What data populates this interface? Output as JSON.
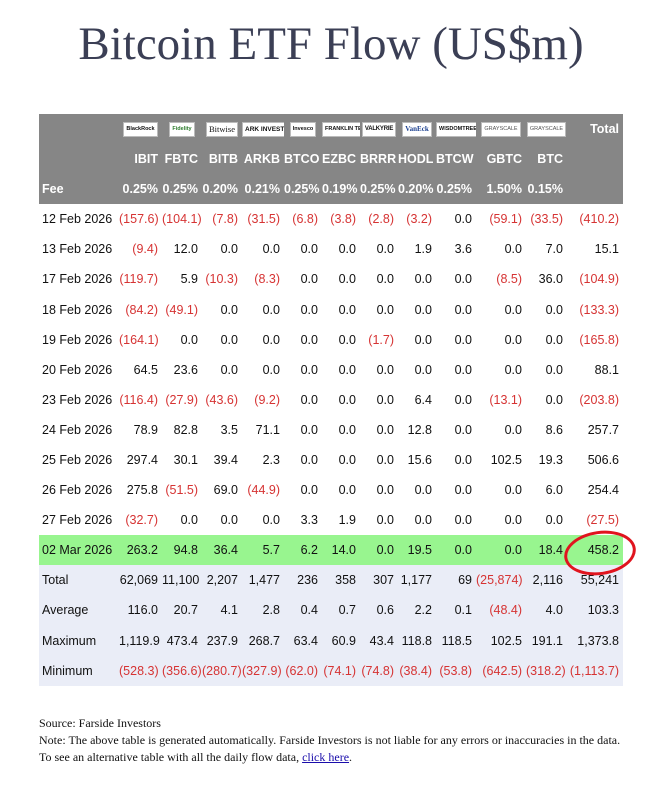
{
  "title": "Bitcoin ETF Flow (US$m)",
  "brands": [
    "BlackRock",
    "Fidelity",
    "Bitwise",
    "ARK INVEST",
    "Invesco",
    "FRANKLIN TEMPLETON",
    "VALKYRIE",
    "VanEck",
    "WISDOMTREE",
    "GRAYSCALE",
    "GRAYSCALE"
  ],
  "total_header": "Total",
  "tickers": [
    "IBIT",
    "FBTC",
    "BITB",
    "ARKB",
    "BTCO",
    "EZBC",
    "BRRR",
    "HODL",
    "BTCW",
    "GBTC",
    "BTC"
  ],
  "fee_label": "Fee",
  "fees": [
    "0.25%",
    "0.25%",
    "0.20%",
    "0.21%",
    "0.25%",
    "0.19%",
    "0.25%",
    "0.20%",
    "0.25%",
    "1.50%",
    "0.15%"
  ],
  "rows": [
    {
      "date": "12 Feb 2026",
      "values": [
        "(157.6)",
        "(104.1)",
        "(7.8)",
        "(31.5)",
        "(6.8)",
        "(3.8)",
        "(2.8)",
        "(3.2)",
        "0.0",
        "(59.1)",
        "(33.5)"
      ],
      "total": "(410.2)"
    },
    {
      "date": "13 Feb 2026",
      "values": [
        "(9.4)",
        "12.0",
        "0.0",
        "0.0",
        "0.0",
        "0.0",
        "0.0",
        "1.9",
        "3.6",
        "0.0",
        "7.0"
      ],
      "total": "15.1"
    },
    {
      "date": "17 Feb 2026",
      "values": [
        "(119.7)",
        "5.9",
        "(10.3)",
        "(8.3)",
        "0.0",
        "0.0",
        "0.0",
        "0.0",
        "0.0",
        "(8.5)",
        "36.0"
      ],
      "total": "(104.9)"
    },
    {
      "date": "18 Feb 2026",
      "values": [
        "(84.2)",
        "(49.1)",
        "0.0",
        "0.0",
        "0.0",
        "0.0",
        "0.0",
        "0.0",
        "0.0",
        "0.0",
        "0.0"
      ],
      "total": "(133.3)"
    },
    {
      "date": "19 Feb 2026",
      "values": [
        "(164.1)",
        "0.0",
        "0.0",
        "0.0",
        "0.0",
        "0.0",
        "(1.7)",
        "0.0",
        "0.0",
        "0.0",
        "0.0"
      ],
      "total": "(165.8)"
    },
    {
      "date": "20 Feb 2026",
      "values": [
        "64.5",
        "23.6",
        "0.0",
        "0.0",
        "0.0",
        "0.0",
        "0.0",
        "0.0",
        "0.0",
        "0.0",
        "0.0"
      ],
      "total": "88.1"
    },
    {
      "date": "23 Feb 2026",
      "values": [
        "(116.4)",
        "(27.9)",
        "(43.6)",
        "(9.2)",
        "0.0",
        "0.0",
        "0.0",
        "6.4",
        "0.0",
        "(13.1)",
        "0.0"
      ],
      "total": "(203.8)"
    },
    {
      "date": "24 Feb 2026",
      "values": [
        "78.9",
        "82.8",
        "3.5",
        "71.1",
        "0.0",
        "0.0",
        "0.0",
        "12.8",
        "0.0",
        "0.0",
        "8.6"
      ],
      "total": "257.7"
    },
    {
      "date": "25 Feb 2026",
      "values": [
        "297.4",
        "30.1",
        "39.4",
        "2.3",
        "0.0",
        "0.0",
        "0.0",
        "15.6",
        "0.0",
        "102.5",
        "19.3"
      ],
      "total": "506.6"
    },
    {
      "date": "26 Feb 2026",
      "values": [
        "275.8",
        "(51.5)",
        "69.0",
        "(44.9)",
        "0.0",
        "0.0",
        "0.0",
        "0.0",
        "0.0",
        "0.0",
        "6.0"
      ],
      "total": "254.4"
    },
    {
      "date": "27 Feb 2026",
      "values": [
        "(32.7)",
        "0.0",
        "0.0",
        "0.0",
        "3.3",
        "1.9",
        "0.0",
        "0.0",
        "0.0",
        "0.0",
        "0.0"
      ],
      "total": "(27.5)"
    },
    {
      "date": "02 Mar 2026",
      "values": [
        "263.2",
        "94.8",
        "36.4",
        "5.7",
        "6.2",
        "14.0",
        "0.0",
        "19.5",
        "0.0",
        "0.0",
        "18.4"
      ],
      "total": "458.2",
      "highlight": true
    }
  ],
  "summary": [
    {
      "label": "Total",
      "values": [
        "62,069",
        "11,100",
        "2,207",
        "1,477",
        "236",
        "358",
        "307",
        "1,177",
        "69",
        "(25,874)",
        "2,116"
      ],
      "total": "55,241"
    },
    {
      "label": "Average",
      "values": [
        "116.0",
        "20.7",
        "4.1",
        "2.8",
        "0.4",
        "0.7",
        "0.6",
        "2.2",
        "0.1",
        "(48.4)",
        "4.0"
      ],
      "total": "103.3"
    },
    {
      "label": "Maximum",
      "values": [
        "1,119.9",
        "473.4",
        "237.9",
        "268.7",
        "63.4",
        "60.9",
        "43.4",
        "118.8",
        "118.5",
        "102.5",
        "191.1"
      ],
      "total": "1,373.8"
    },
    {
      "label": "Minimum",
      "values": [
        "(528.3)",
        "(356.6)",
        "(280.7)",
        "(327.9)",
        "(62.0)",
        "(74.1)",
        "(74.8)",
        "(38.4)",
        "(53.8)",
        "(642.5)",
        "(318.2)"
      ],
      "total": "(1,113.7)"
    }
  ],
  "source": "Source: Farside Investors",
  "note_text": "Note: The above table is generated automatically. Farside Investors is not liable for any errors or inaccuracies in the data. To see an alternative table with all the daily flow data,",
  "note_link": "click here",
  "note_end": ".",
  "colors": {
    "header_bg": "#868686",
    "negative": "#d63333",
    "highlight_row": "#98f58f",
    "summary_bg": "#eaedf7",
    "circle": "#e0141e"
  }
}
